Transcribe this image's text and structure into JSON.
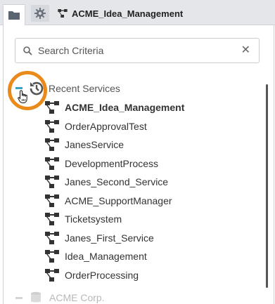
{
  "topbar": {
    "title": "ACME_Idea_Management"
  },
  "search": {
    "placeholder": "Search Criteria",
    "clear_symbol": "✕"
  },
  "recent": {
    "label": "Recent Services",
    "items": [
      {
        "label": "ACME_Idea_Management",
        "selected": true
      },
      {
        "label": "OrderApprovalTest",
        "selected": false
      },
      {
        "label": "JanesService",
        "selected": false
      },
      {
        "label": "DevelopmentProcess",
        "selected": false
      },
      {
        "label": "Janes_Second_Service",
        "selected": false
      },
      {
        "label": "ACME_SupportManager",
        "selected": false
      },
      {
        "label": "Ticketsystem",
        "selected": false
      },
      {
        "label": "Janes_First_Service",
        "selected": false
      },
      {
        "label": "Idea_Management",
        "selected": false
      },
      {
        "label": "OrderProcessing",
        "selected": false
      }
    ]
  },
  "bottom": {
    "label": "ACME Corp."
  },
  "colors": {
    "highlight_ring": "#ea8a1a",
    "collapse_accent": "#3aa0c8",
    "topbar_bg": "#e4e6e9"
  }
}
